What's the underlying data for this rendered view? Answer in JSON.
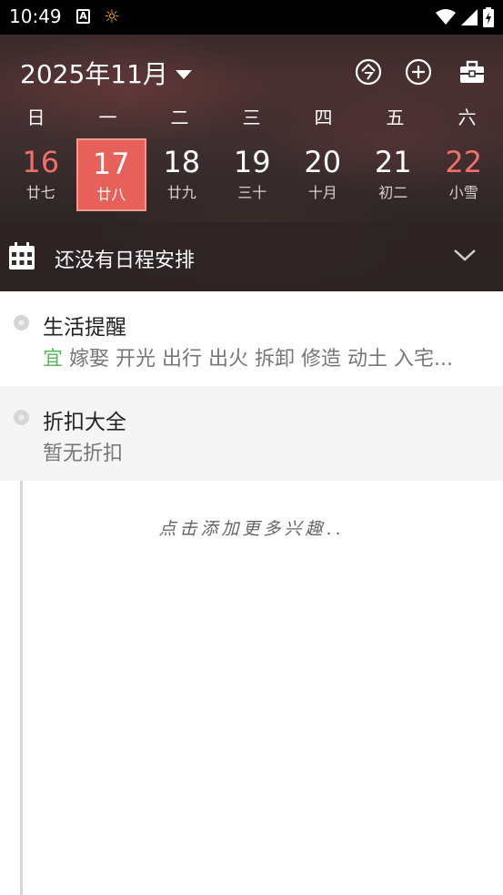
{
  "status_bar": {
    "time": "10:49",
    "notif_icon_letter": "A"
  },
  "header": {
    "month_label": "2025年11月"
  },
  "weekdays": [
    "日",
    "一",
    "二",
    "三",
    "四",
    "五",
    "六"
  ],
  "days": [
    {
      "num": "16",
      "lunar": "廿七",
      "weekend": true,
      "selected": false
    },
    {
      "num": "17",
      "lunar": "廿八",
      "weekend": false,
      "selected": true
    },
    {
      "num": "18",
      "lunar": "廿九",
      "weekend": false,
      "selected": false
    },
    {
      "num": "19",
      "lunar": "三十",
      "weekend": false,
      "selected": false
    },
    {
      "num": "20",
      "lunar": "十月",
      "weekend": false,
      "selected": false
    },
    {
      "num": "21",
      "lunar": "初二",
      "weekend": false,
      "selected": false
    },
    {
      "num": "22",
      "lunar": "小雪",
      "weekend": true,
      "selected": false
    }
  ],
  "schedule": {
    "empty_text": "还没有日程安排"
  },
  "cards": [
    {
      "title": "生活提醒",
      "prefix": "宜",
      "sub": " 嫁娶 开光 出行 出火 拆卸 修造 动土 入宅..."
    },
    {
      "title": "折扣大全",
      "prefix": "",
      "sub": "暂无折扣"
    }
  ],
  "add_interest": "点击添加更多兴趣..",
  "colors": {
    "accent": "#e8605a",
    "weekend": "#f07068",
    "yi_green": "#5cb85c"
  }
}
